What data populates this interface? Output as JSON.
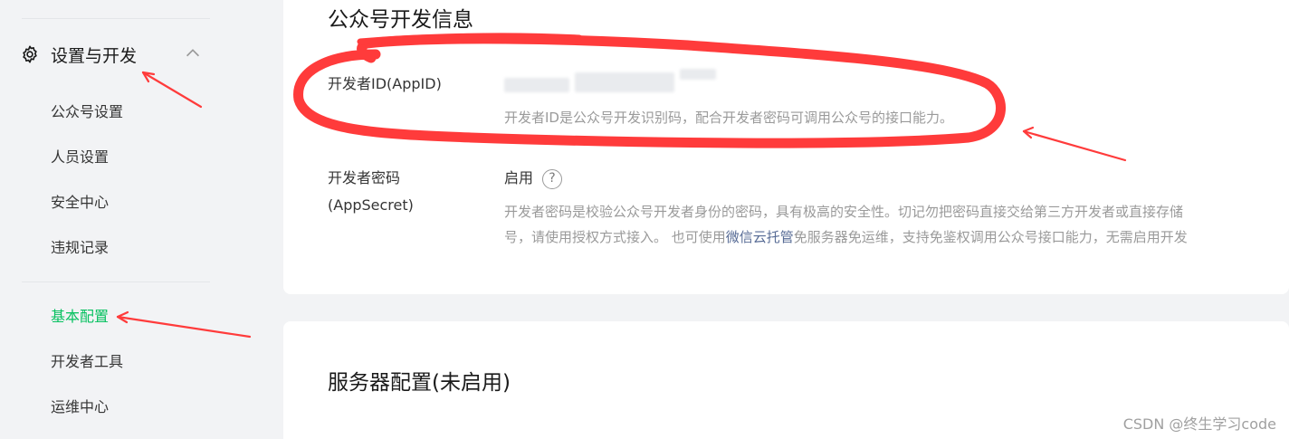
{
  "sidebar": {
    "group_label": "设置与开发",
    "group_icon": "gear-icon",
    "collapse_icon": "chevron-up-icon",
    "items": [
      {
        "label": "公众号设置"
      },
      {
        "label": "人员设置"
      },
      {
        "label": "安全中心"
      },
      {
        "label": "违规记录"
      },
      {
        "label": "基本配置",
        "active": true
      },
      {
        "label": "开发者工具"
      },
      {
        "label": "运维中心"
      }
    ]
  },
  "dev_info": {
    "title": "公众号开发信息",
    "appid_label": "开发者ID(AppID)",
    "appid_desc": "开发者ID是公众号开发识别码，配合开发者密码可调用公众号的接口能力。",
    "secret_label": "开发者密码(AppSecret)",
    "secret_value": "启用",
    "secret_help": "?",
    "secret_desc_line1": "开发者密码是校验公众号开发者身份的密码，具有极高的安全性。切记勿把密码直接交给第三方开发者或直接存储",
    "secret_desc_line2_a": "号，请使用授权方式接入。 也可使用",
    "secret_desc_link": "微信云托管",
    "secret_desc_line2_b": "免服务器免运维，支持免鉴权调用公众号接口能力，无需启用开发"
  },
  "server_config": {
    "title": "服务器配置(未启用)"
  },
  "watermark": "CSDN @终生学习code",
  "colors": {
    "accent": "#07c160",
    "link": "#576b95",
    "annotation": "#ff3b3b",
    "background": "#f2f3f5"
  }
}
